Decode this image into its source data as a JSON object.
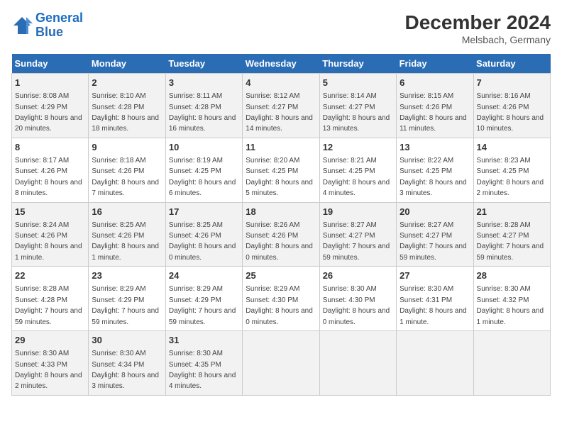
{
  "logo": {
    "line1": "General",
    "line2": "Blue"
  },
  "title": "December 2024",
  "subtitle": "Melsbach, Germany",
  "days_of_week": [
    "Sunday",
    "Monday",
    "Tuesday",
    "Wednesday",
    "Thursday",
    "Friday",
    "Saturday"
  ],
  "weeks": [
    [
      {
        "day": 1,
        "sunrise": "8:08 AM",
        "sunset": "4:29 PM",
        "daylight": "8 hours and 20 minutes."
      },
      {
        "day": 2,
        "sunrise": "8:10 AM",
        "sunset": "4:28 PM",
        "daylight": "8 hours and 18 minutes."
      },
      {
        "day": 3,
        "sunrise": "8:11 AM",
        "sunset": "4:28 PM",
        "daylight": "8 hours and 16 minutes."
      },
      {
        "day": 4,
        "sunrise": "8:12 AM",
        "sunset": "4:27 PM",
        "daylight": "8 hours and 14 minutes."
      },
      {
        "day": 5,
        "sunrise": "8:14 AM",
        "sunset": "4:27 PM",
        "daylight": "8 hours and 13 minutes."
      },
      {
        "day": 6,
        "sunrise": "8:15 AM",
        "sunset": "4:26 PM",
        "daylight": "8 hours and 11 minutes."
      },
      {
        "day": 7,
        "sunrise": "8:16 AM",
        "sunset": "4:26 PM",
        "daylight": "8 hours and 10 minutes."
      }
    ],
    [
      {
        "day": 8,
        "sunrise": "8:17 AM",
        "sunset": "4:26 PM",
        "daylight": "8 hours and 8 minutes."
      },
      {
        "day": 9,
        "sunrise": "8:18 AM",
        "sunset": "4:26 PM",
        "daylight": "8 hours and 7 minutes."
      },
      {
        "day": 10,
        "sunrise": "8:19 AM",
        "sunset": "4:25 PM",
        "daylight": "8 hours and 6 minutes."
      },
      {
        "day": 11,
        "sunrise": "8:20 AM",
        "sunset": "4:25 PM",
        "daylight": "8 hours and 5 minutes."
      },
      {
        "day": 12,
        "sunrise": "8:21 AM",
        "sunset": "4:25 PM",
        "daylight": "8 hours and 4 minutes."
      },
      {
        "day": 13,
        "sunrise": "8:22 AM",
        "sunset": "4:25 PM",
        "daylight": "8 hours and 3 minutes."
      },
      {
        "day": 14,
        "sunrise": "8:23 AM",
        "sunset": "4:25 PM",
        "daylight": "8 hours and 2 minutes."
      }
    ],
    [
      {
        "day": 15,
        "sunrise": "8:24 AM",
        "sunset": "4:26 PM",
        "daylight": "8 hours and 1 minute."
      },
      {
        "day": 16,
        "sunrise": "8:25 AM",
        "sunset": "4:26 PM",
        "daylight": "8 hours and 1 minute."
      },
      {
        "day": 17,
        "sunrise": "8:25 AM",
        "sunset": "4:26 PM",
        "daylight": "8 hours and 0 minutes."
      },
      {
        "day": 18,
        "sunrise": "8:26 AM",
        "sunset": "4:26 PM",
        "daylight": "8 hours and 0 minutes."
      },
      {
        "day": 19,
        "sunrise": "8:27 AM",
        "sunset": "4:27 PM",
        "daylight": "7 hours and 59 minutes."
      },
      {
        "day": 20,
        "sunrise": "8:27 AM",
        "sunset": "4:27 PM",
        "daylight": "7 hours and 59 minutes."
      },
      {
        "day": 21,
        "sunrise": "8:28 AM",
        "sunset": "4:27 PM",
        "daylight": "7 hours and 59 minutes."
      }
    ],
    [
      {
        "day": 22,
        "sunrise": "8:28 AM",
        "sunset": "4:28 PM",
        "daylight": "7 hours and 59 minutes."
      },
      {
        "day": 23,
        "sunrise": "8:29 AM",
        "sunset": "4:29 PM",
        "daylight": "7 hours and 59 minutes."
      },
      {
        "day": 24,
        "sunrise": "8:29 AM",
        "sunset": "4:29 PM",
        "daylight": "7 hours and 59 minutes."
      },
      {
        "day": 25,
        "sunrise": "8:29 AM",
        "sunset": "4:30 PM",
        "daylight": "8 hours and 0 minutes."
      },
      {
        "day": 26,
        "sunrise": "8:30 AM",
        "sunset": "4:30 PM",
        "daylight": "8 hours and 0 minutes."
      },
      {
        "day": 27,
        "sunrise": "8:30 AM",
        "sunset": "4:31 PM",
        "daylight": "8 hours and 1 minute."
      },
      {
        "day": 28,
        "sunrise": "8:30 AM",
        "sunset": "4:32 PM",
        "daylight": "8 hours and 1 minute."
      }
    ],
    [
      {
        "day": 29,
        "sunrise": "8:30 AM",
        "sunset": "4:33 PM",
        "daylight": "8 hours and 2 minutes."
      },
      {
        "day": 30,
        "sunrise": "8:30 AM",
        "sunset": "4:34 PM",
        "daylight": "8 hours and 3 minutes."
      },
      {
        "day": 31,
        "sunrise": "8:30 AM",
        "sunset": "4:35 PM",
        "daylight": "8 hours and 4 minutes."
      },
      null,
      null,
      null,
      null
    ]
  ]
}
